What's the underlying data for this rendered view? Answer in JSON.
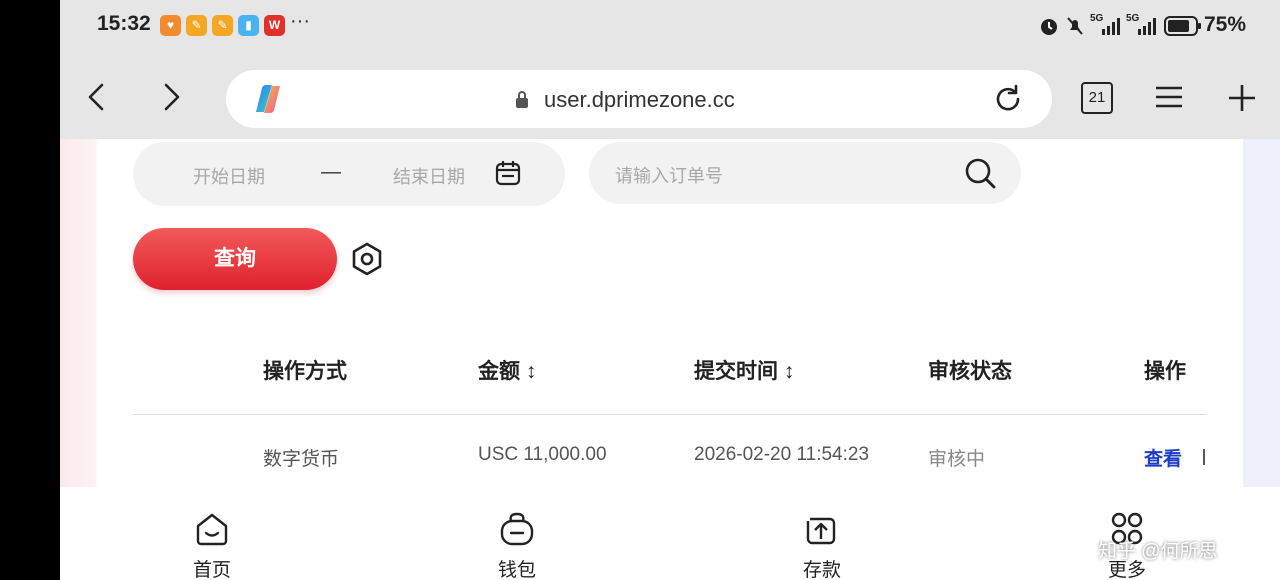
{
  "status_bar": {
    "time": "15:32",
    "more": "···",
    "app_icons": [
      {
        "name": "app-icon-1",
        "color": "#f28a2e"
      },
      {
        "name": "app-icon-2",
        "color": "#f5a623"
      },
      {
        "name": "app-icon-3",
        "color": "#f5a623"
      },
      {
        "name": "app-icon-4",
        "color": "#4ab4f2"
      },
      {
        "name": "wps-icon",
        "color": "#e0312b",
        "letter": "W"
      }
    ],
    "signal_1": "5G",
    "signal_2": "5G",
    "battery": "75%"
  },
  "browser": {
    "url": "user.dprimezone.cc",
    "tab_count": "21"
  },
  "filters": {
    "start_date_placeholder": "开始日期",
    "dash": "—",
    "end_date_placeholder": "结束日期",
    "order_placeholder": "请输入订单号",
    "query_label": "查询"
  },
  "table": {
    "headers": {
      "method": "操作方式",
      "amount": "金额 ↕",
      "time": "提交时间 ↕",
      "status": "审核状态",
      "action": "操作"
    },
    "rows": [
      {
        "method": "数字货币",
        "amount": "USC 11,000.00",
        "time": "2026-02-20 11:54:23",
        "status": "审核中",
        "action": "查看"
      }
    ]
  },
  "bottom_nav": {
    "home": "首页",
    "wallet": "钱包",
    "deposit": "存款",
    "more": "更多"
  },
  "watermark": "知乎 @何所思",
  "colors": {
    "accent_red": "#e0212e",
    "link_blue": "#1a3cc7"
  }
}
